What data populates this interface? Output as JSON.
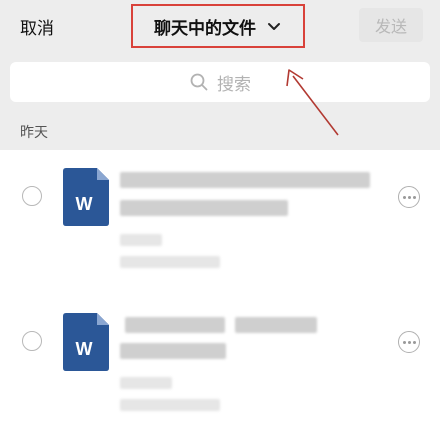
{
  "header": {
    "cancel_label": "取消",
    "title": "聊天中的文件",
    "send_label": "发送"
  },
  "search": {
    "placeholder": "搜索"
  },
  "section": {
    "label": "昨天"
  },
  "files": [
    {
      "icon_letter": "W",
      "type": "word-document"
    },
    {
      "icon_letter": "W",
      "type": "word-document"
    }
  ],
  "colors": {
    "header_bg": "#ededed",
    "highlight_border": "#d9423a",
    "word_icon": "#2b5797",
    "send_disabled_bg": "#e6e6e6",
    "send_disabled_text": "#b8b8b8"
  }
}
